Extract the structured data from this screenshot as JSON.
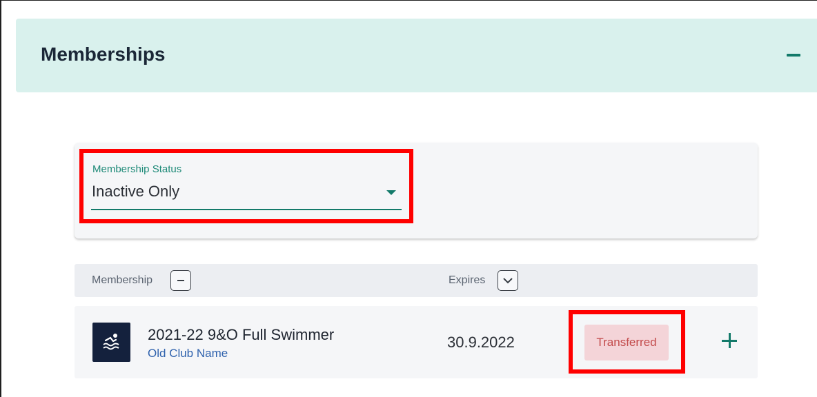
{
  "section": {
    "title": "Memberships"
  },
  "filter": {
    "label": "Membership Status",
    "value": "Inactive Only"
  },
  "table": {
    "columns": [
      {
        "label": "Membership",
        "sort_icon": "minus-icon"
      },
      {
        "label": "Expires",
        "sort_icon": "chevron-down-icon"
      }
    ],
    "rows": [
      {
        "icon": "swimmer-icon",
        "name": "2021-22 9&O Full Swimmer",
        "club": "Old Club Name",
        "expires": "30.9.2022",
        "status": "Transferred",
        "action_icon": "plus-icon"
      }
    ]
  },
  "colors": {
    "accent": "#137a6a",
    "header_bg": "#d9f1ed",
    "highlight": "#ff0000",
    "badge_bg": "#f4d4d8",
    "badge_text": "#c24a4a"
  }
}
